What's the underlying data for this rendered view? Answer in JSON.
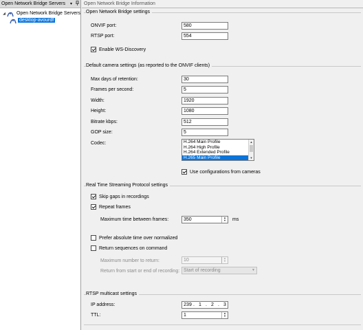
{
  "left_panel": {
    "title": "Open Network Bridge Servers",
    "pin_glyph": "▾",
    "close_glyph": "⨯",
    "tree": {
      "root_label": "Open Network Bridge Servers",
      "root_expander": "◢",
      "child_label": "desktop-avourdf"
    }
  },
  "right_panel": {
    "title": "Open Network Bridge Information",
    "onb_settings": {
      "title": "Open Network Bridge settings",
      "onvif_port_label": "ONVIF port:",
      "onvif_port_value": "580",
      "rtsp_port_label": "RTSP port:",
      "rtsp_port_value": "554",
      "ws_discovery_label": "Enable WS-Discovery",
      "ws_discovery_checked": true
    },
    "camera_settings": {
      "title": "Default camera settings (as reported to the ONVIF clients)",
      "retention_label": "Max days of retention:",
      "retention_value": "30",
      "fps_label": "Frames per second:",
      "fps_value": "5",
      "width_label": "Width:",
      "width_value": "1920",
      "height_label": "Height:",
      "height_value": "1080",
      "bitrate_label": "Bitrate kbps:",
      "bitrate_value": "512",
      "gop_label": "GOP size:",
      "gop_value": "5",
      "codec_label": "Codec:",
      "codec_options": [
        "H.264 Main Profile",
        "H.264 High Profile",
        "H.264 Extended Profile",
        "H.265 Main Profile"
      ],
      "codec_selected_index": 3,
      "use_config_label": "Use configurations from cameras",
      "use_config_checked": true
    },
    "rtsp_settings": {
      "title": "Real Time Streaming Protocol settings",
      "skip_gaps_label": "Skip gaps in recordings",
      "skip_gaps_checked": true,
      "repeat_frames_label": "Repeat frames",
      "repeat_frames_checked": true,
      "max_time_label": "Maximum time between frames:",
      "max_time_value": "350",
      "max_time_unit": "ms",
      "prefer_absolute_label": "Prefer absolute time over normalized",
      "prefer_absolute_checked": false,
      "return_sequences_label": "Return sequences on command",
      "return_sequences_checked": false,
      "max_return_label": "Maximum number to return:",
      "max_return_value": "10",
      "return_from_label": "Return from start or end of recording:",
      "return_from_value": "Start of recording"
    },
    "multicast_settings": {
      "title": "RTSP multicast settings",
      "ip_label": "IP address:",
      "ip_parts": [
        "239",
        "1",
        "2",
        "3"
      ],
      "ttl_label": "TTL:",
      "ttl_value": "1"
    }
  },
  "icons": {
    "tree_root": "server-group-icon",
    "tree_child": "server-icon",
    "spin_up": "▲",
    "spin_down": "▼",
    "combo_arrow": "▼"
  }
}
